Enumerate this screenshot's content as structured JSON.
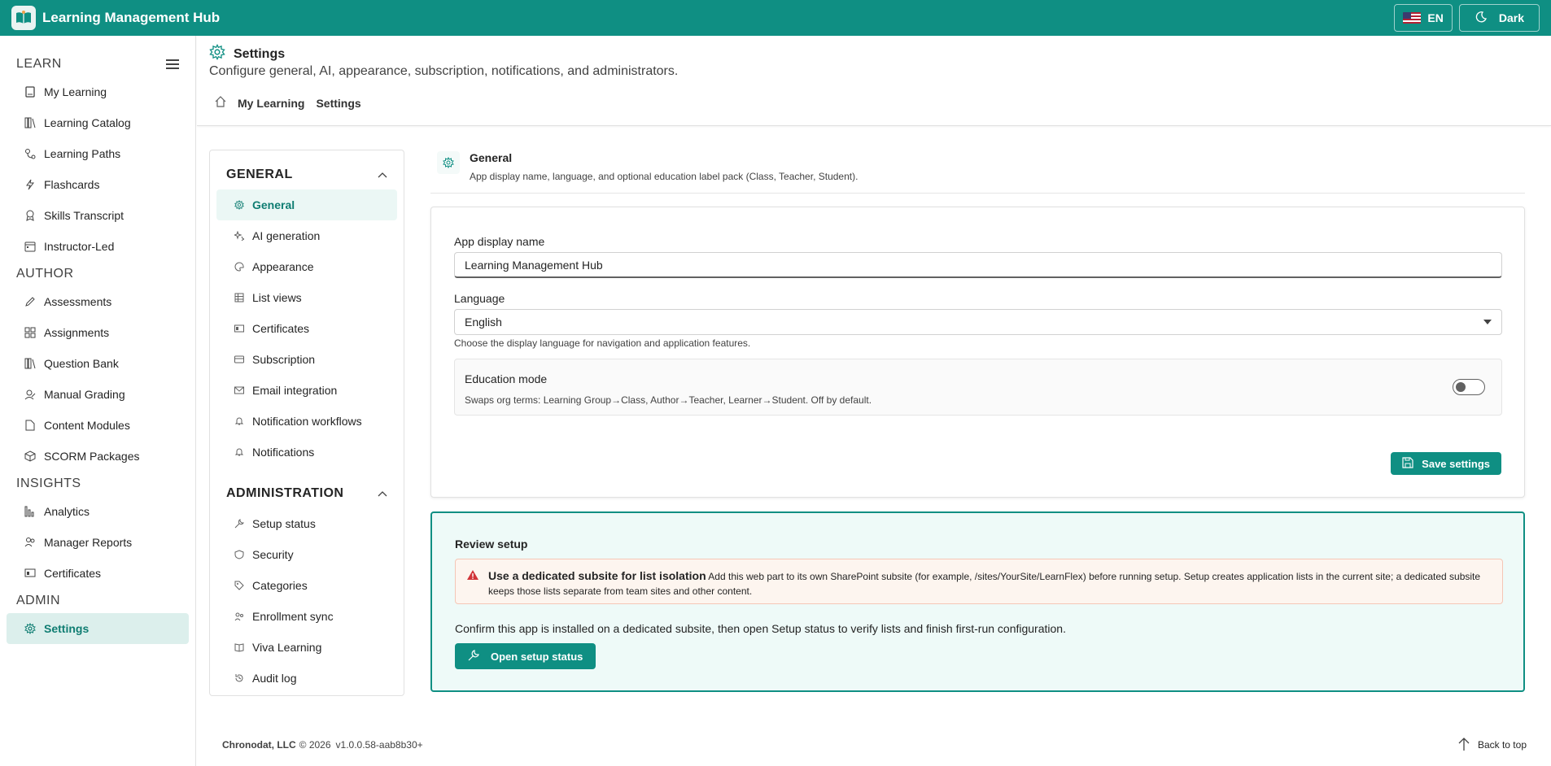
{
  "app": {
    "title": "Learning Management Hub",
    "language_button": "EN",
    "theme_button": "Dark"
  },
  "colors": {
    "accent": "#0f8f83",
    "accent_light": "#eefaf8",
    "warning": "#d13438"
  },
  "sidebar": {
    "sections": [
      {
        "title": "LEARN",
        "items": [
          {
            "label": "My Learning",
            "icon": "book-icon"
          },
          {
            "label": "Learning Catalog",
            "icon": "library-icon"
          },
          {
            "label": "Learning Paths",
            "icon": "path-icon"
          },
          {
            "label": "Flashcards",
            "icon": "flash-icon"
          },
          {
            "label": "Skills Transcript",
            "icon": "ribbon-icon"
          },
          {
            "label": "Instructor-Led",
            "icon": "calendar-icon"
          }
        ]
      },
      {
        "title": "AUTHOR",
        "items": [
          {
            "label": "Assessments",
            "icon": "pen-icon"
          },
          {
            "label": "Assignments",
            "icon": "grid-icon"
          },
          {
            "label": "Question Bank",
            "icon": "library-icon"
          },
          {
            "label": "Manual Grading",
            "icon": "grading-icon"
          },
          {
            "label": "Content Modules",
            "icon": "document-icon"
          },
          {
            "label": "SCORM Packages",
            "icon": "cube-icon"
          }
        ]
      },
      {
        "title": "INSIGHTS",
        "items": [
          {
            "label": "Analytics",
            "icon": "chart-icon"
          },
          {
            "label": "Manager Reports",
            "icon": "people-icon"
          },
          {
            "label": "Certificates",
            "icon": "certificate-icon"
          }
        ]
      },
      {
        "title": "ADMIN",
        "items": [
          {
            "label": "Settings",
            "icon": "gear-icon",
            "active": true
          }
        ]
      }
    ]
  },
  "header": {
    "title": "Settings",
    "subtitle": "Configure general, AI, appearance, subscription, notifications, and administrators.",
    "breadcrumb": [
      "My Learning",
      "Settings"
    ]
  },
  "settings_nav": {
    "general": {
      "title": "GENERAL",
      "items": [
        {
          "label": "General",
          "icon": "gear-icon",
          "active": true
        },
        {
          "label": "AI generation",
          "icon": "sparkle-icon"
        },
        {
          "label": "Appearance",
          "icon": "palette-icon"
        },
        {
          "label": "List views",
          "icon": "table-icon"
        },
        {
          "label": "Certificates",
          "icon": "certificate-icon"
        },
        {
          "label": "Subscription",
          "icon": "card-icon"
        },
        {
          "label": "Email integration",
          "icon": "mail-icon"
        },
        {
          "label": "Notification workflows",
          "icon": "bell-icon"
        },
        {
          "label": "Notifications",
          "icon": "bell-icon"
        }
      ]
    },
    "administration": {
      "title": "ADMINISTRATION",
      "items": [
        {
          "label": "Setup status",
          "icon": "wrench-icon"
        },
        {
          "label": "Security",
          "icon": "shield-icon"
        },
        {
          "label": "Categories",
          "icon": "tag-icon"
        },
        {
          "label": "Enrollment sync",
          "icon": "sync-icon"
        },
        {
          "label": "Viva Learning",
          "icon": "book-open-icon"
        },
        {
          "label": "Audit log",
          "icon": "history-icon"
        }
      ]
    }
  },
  "section": {
    "title": "General",
    "description": "App display name, language, and optional education label pack (Class, Teacher, Student)."
  },
  "form": {
    "display_name_label": "App display name",
    "display_name_value": "Learning Management Hub",
    "language_label": "Language",
    "language_value": "English",
    "language_hint": "Choose the display language for navigation and application features.",
    "education_title": "Education mode",
    "education_desc": "Swaps org terms: Learning Group→Class, Author→Teacher, Learner→Student. Off by default.",
    "save_label": "Save settings"
  },
  "review": {
    "title": "Review setup",
    "warning_title": "Use a dedicated subsite for list isolation",
    "warning_body": "Add this web part to its own SharePoint subsite (for example, /sites/YourSite/LearnFlex) before running setup. Setup creates application lists in the current site; a dedicated subsite keeps those lists separate from team sites and other content.",
    "confirm_text": "Confirm this app is installed on a dedicated subsite, then open Setup status to verify lists and finish first-run configuration.",
    "button_label": "Open setup status"
  },
  "footer": {
    "company": "Chronodat, LLC",
    "copyright": "© 2026",
    "version": "v1.0.0.58-aab8b30+",
    "back_to_top": "Back to top"
  }
}
